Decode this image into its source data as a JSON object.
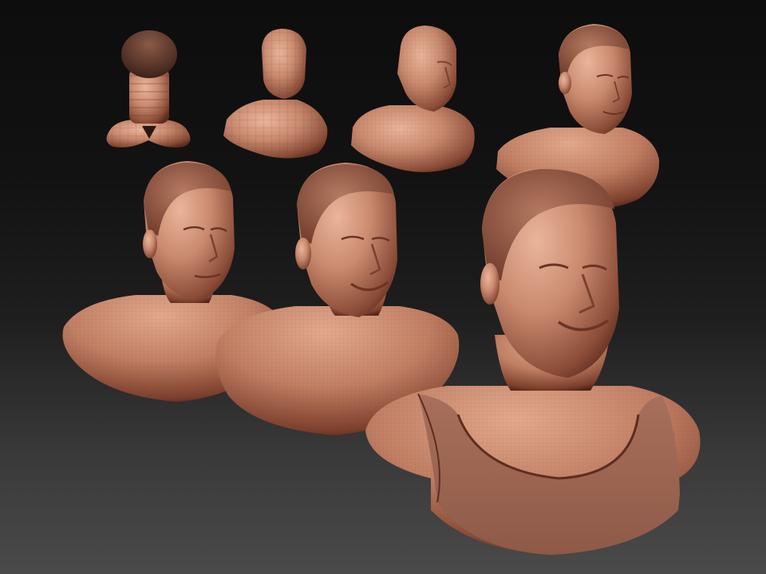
{
  "scene": {
    "background_top": "#0d0d0d",
    "background_bottom": "#4a4a4a",
    "skin_color": "#c98a6f",
    "skin_shadow": "#7a4230",
    "skin_highlight": "#e8b39a",
    "stages": [
      {
        "id": "stage-1",
        "detail": "primitive-base-mesh"
      },
      {
        "id": "stage-2",
        "detail": "low-poly-blockout"
      },
      {
        "id": "stage-3",
        "detail": "basic-face-forms"
      },
      {
        "id": "stage-4",
        "detail": "defined-features"
      },
      {
        "id": "stage-5",
        "detail": "refined-bust"
      },
      {
        "id": "stage-6",
        "detail": "smiling-refined-bust"
      },
      {
        "id": "stage-7",
        "detail": "final-bust-with-tank-top"
      }
    ]
  }
}
